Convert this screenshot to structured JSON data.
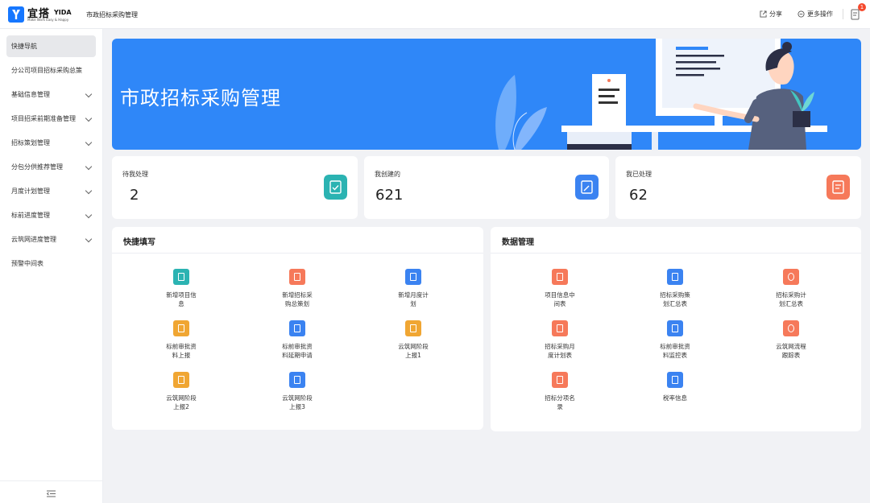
{
  "header": {
    "logo_cn": "宜搭",
    "logo_en": "YIDA",
    "logo_tagline": "Make Work Easy & Happy",
    "app_title": "市政招标采购管理",
    "share_label": "分享",
    "more_label": "更多操作",
    "notice_count": "1"
  },
  "sidebar": {
    "items": [
      {
        "label": "快捷导航",
        "expandable": false
      },
      {
        "label": "分公司项目招标采购总策",
        "expandable": false
      },
      {
        "label": "基础信息管理",
        "expandable": true
      },
      {
        "label": "项目招采前期准备管理",
        "expandable": true
      },
      {
        "label": "招标策划管理",
        "expandable": true
      },
      {
        "label": "分包分供推荐管理",
        "expandable": true
      },
      {
        "label": "月度计划管理",
        "expandable": true
      },
      {
        "label": "标前进度管理",
        "expandable": true
      },
      {
        "label": "云筑网进度管理",
        "expandable": true
      },
      {
        "label": "预警中间表",
        "expandable": false
      }
    ]
  },
  "banner": {
    "title": "市政招标采购管理"
  },
  "stats": [
    {
      "label": "待我处理",
      "value": "2",
      "color": "#2bb3b2"
    },
    {
      "label": "我创建的",
      "value": "621",
      "color": "#3b83f1"
    },
    {
      "label": "我已处理",
      "value": "62",
      "color": "#f6795a"
    }
  ],
  "quick_fill": {
    "title": "快捷填写",
    "items": [
      {
        "label": "新增项目信息",
        "color": "teal",
        "icon": "form-icon"
      },
      {
        "label": "新增招标采购总策划",
        "color": "salmon",
        "icon": "form-icon"
      },
      {
        "label": "新增月度计划",
        "color": "blue",
        "icon": "form-icon"
      },
      {
        "label": "标前审批资料上报",
        "color": "orange",
        "icon": "form-icon"
      },
      {
        "label": "标前审批资料延期申请",
        "color": "blue",
        "icon": "form-icon"
      },
      {
        "label": "云筑网阶段上报1",
        "color": "orange",
        "icon": "form-icon"
      },
      {
        "label": "云筑网阶段上报2",
        "color": "orange",
        "icon": "form-icon"
      },
      {
        "label": "云筑网阶段上报3",
        "color": "blue",
        "icon": "form-icon"
      }
    ]
  },
  "data_mgmt": {
    "title": "数据管理",
    "items": [
      {
        "label": "项目信息中间表",
        "color": "salmon",
        "icon": "report-icon"
      },
      {
        "label": "招标采购策划汇总表",
        "color": "blue",
        "icon": "home-icon"
      },
      {
        "label": "招标采购计划汇总表",
        "color": "salmon",
        "icon": "globe-icon"
      },
      {
        "label": "招标采购月度计划表",
        "color": "salmon",
        "icon": "report-icon"
      },
      {
        "label": "标前审批资料监控表",
        "color": "blue",
        "icon": "home-icon"
      },
      {
        "label": "云筑网流程跟踪表",
        "color": "salmon",
        "icon": "globe-icon"
      },
      {
        "label": "招标分项名录",
        "color": "salmon",
        "icon": "report-icon"
      },
      {
        "label": "税率信息",
        "color": "blue",
        "icon": "home-icon"
      }
    ]
  }
}
